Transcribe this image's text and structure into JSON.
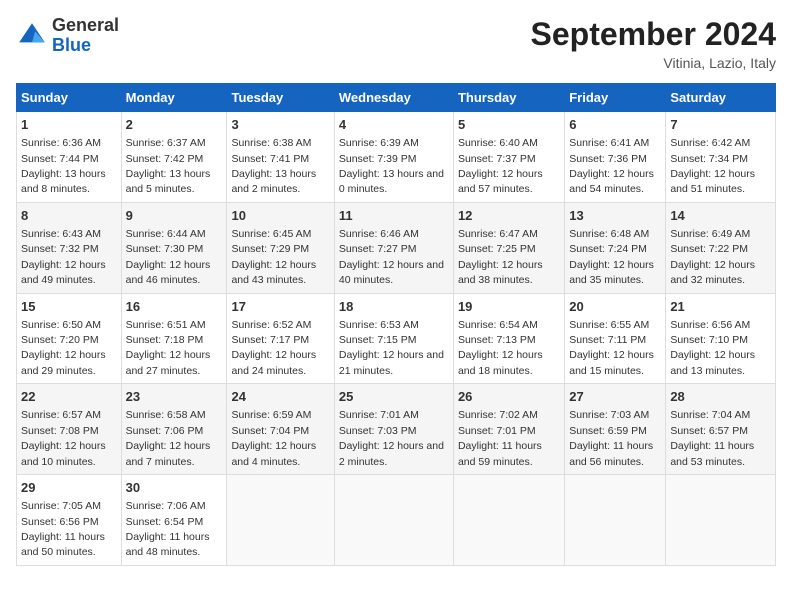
{
  "header": {
    "logo_general": "General",
    "logo_blue": "Blue",
    "month_title": "September 2024",
    "location": "Vitinia, Lazio, Italy"
  },
  "days_of_week": [
    "Sunday",
    "Monday",
    "Tuesday",
    "Wednesday",
    "Thursday",
    "Friday",
    "Saturday"
  ],
  "weeks": [
    [
      {
        "day": "1",
        "sunrise": "6:36 AM",
        "sunset": "7:44 PM",
        "daylight": "13 hours and 8 minutes."
      },
      {
        "day": "2",
        "sunrise": "6:37 AM",
        "sunset": "7:42 PM",
        "daylight": "13 hours and 5 minutes."
      },
      {
        "day": "3",
        "sunrise": "6:38 AM",
        "sunset": "7:41 PM",
        "daylight": "13 hours and 2 minutes."
      },
      {
        "day": "4",
        "sunrise": "6:39 AM",
        "sunset": "7:39 PM",
        "daylight": "13 hours and 0 minutes."
      },
      {
        "day": "5",
        "sunrise": "6:40 AM",
        "sunset": "7:37 PM",
        "daylight": "12 hours and 57 minutes."
      },
      {
        "day": "6",
        "sunrise": "6:41 AM",
        "sunset": "7:36 PM",
        "daylight": "12 hours and 54 minutes."
      },
      {
        "day": "7",
        "sunrise": "6:42 AM",
        "sunset": "7:34 PM",
        "daylight": "12 hours and 51 minutes."
      }
    ],
    [
      {
        "day": "8",
        "sunrise": "6:43 AM",
        "sunset": "7:32 PM",
        "daylight": "12 hours and 49 minutes."
      },
      {
        "day": "9",
        "sunrise": "6:44 AM",
        "sunset": "7:30 PM",
        "daylight": "12 hours and 46 minutes."
      },
      {
        "day": "10",
        "sunrise": "6:45 AM",
        "sunset": "7:29 PM",
        "daylight": "12 hours and 43 minutes."
      },
      {
        "day": "11",
        "sunrise": "6:46 AM",
        "sunset": "7:27 PM",
        "daylight": "12 hours and 40 minutes."
      },
      {
        "day": "12",
        "sunrise": "6:47 AM",
        "sunset": "7:25 PM",
        "daylight": "12 hours and 38 minutes."
      },
      {
        "day": "13",
        "sunrise": "6:48 AM",
        "sunset": "7:24 PM",
        "daylight": "12 hours and 35 minutes."
      },
      {
        "day": "14",
        "sunrise": "6:49 AM",
        "sunset": "7:22 PM",
        "daylight": "12 hours and 32 minutes."
      }
    ],
    [
      {
        "day": "15",
        "sunrise": "6:50 AM",
        "sunset": "7:20 PM",
        "daylight": "12 hours and 29 minutes."
      },
      {
        "day": "16",
        "sunrise": "6:51 AM",
        "sunset": "7:18 PM",
        "daylight": "12 hours and 27 minutes."
      },
      {
        "day": "17",
        "sunrise": "6:52 AM",
        "sunset": "7:17 PM",
        "daylight": "12 hours and 24 minutes."
      },
      {
        "day": "18",
        "sunrise": "6:53 AM",
        "sunset": "7:15 PM",
        "daylight": "12 hours and 21 minutes."
      },
      {
        "day": "19",
        "sunrise": "6:54 AM",
        "sunset": "7:13 PM",
        "daylight": "12 hours and 18 minutes."
      },
      {
        "day": "20",
        "sunrise": "6:55 AM",
        "sunset": "7:11 PM",
        "daylight": "12 hours and 15 minutes."
      },
      {
        "day": "21",
        "sunrise": "6:56 AM",
        "sunset": "7:10 PM",
        "daylight": "12 hours and 13 minutes."
      }
    ],
    [
      {
        "day": "22",
        "sunrise": "6:57 AM",
        "sunset": "7:08 PM",
        "daylight": "12 hours and 10 minutes."
      },
      {
        "day": "23",
        "sunrise": "6:58 AM",
        "sunset": "7:06 PM",
        "daylight": "12 hours and 7 minutes."
      },
      {
        "day": "24",
        "sunrise": "6:59 AM",
        "sunset": "7:04 PM",
        "daylight": "12 hours and 4 minutes."
      },
      {
        "day": "25",
        "sunrise": "7:01 AM",
        "sunset": "7:03 PM",
        "daylight": "12 hours and 2 minutes."
      },
      {
        "day": "26",
        "sunrise": "7:02 AM",
        "sunset": "7:01 PM",
        "daylight": "11 hours and 59 minutes."
      },
      {
        "day": "27",
        "sunrise": "7:03 AM",
        "sunset": "6:59 PM",
        "daylight": "11 hours and 56 minutes."
      },
      {
        "day": "28",
        "sunrise": "7:04 AM",
        "sunset": "6:57 PM",
        "daylight": "11 hours and 53 minutes."
      }
    ],
    [
      {
        "day": "29",
        "sunrise": "7:05 AM",
        "sunset": "6:56 PM",
        "daylight": "11 hours and 50 minutes."
      },
      {
        "day": "30",
        "sunrise": "7:06 AM",
        "sunset": "6:54 PM",
        "daylight": "11 hours and 48 minutes."
      },
      null,
      null,
      null,
      null,
      null
    ]
  ]
}
